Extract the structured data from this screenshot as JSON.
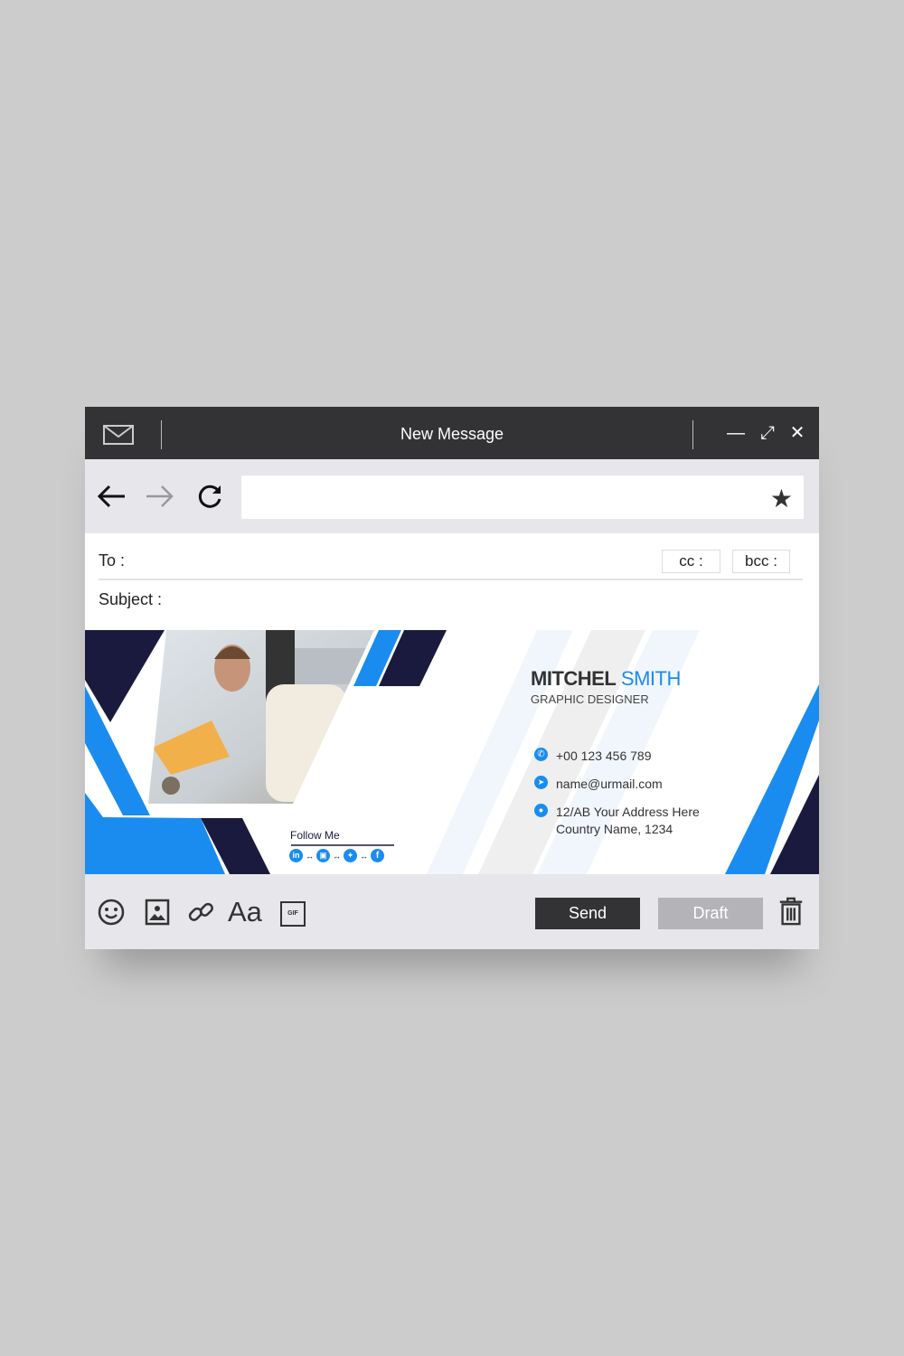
{
  "window": {
    "title": "New Message"
  },
  "compose": {
    "to_label": "To :",
    "subject_label": "Subject :",
    "cc_label": "cc :",
    "bcc_label": "bcc :",
    "url_value": ""
  },
  "signature": {
    "first_name": "MITCHEL",
    "last_name": "SMITH",
    "role": "GRAPHIC DESIGNER",
    "phone": "+00 123 456 789",
    "email": "name@urmail.com",
    "address_line1": "12/AB Your Address Here",
    "address_line2": "Country Name, 1234",
    "follow_label": "Follow Me",
    "social": [
      "linkedin-icon",
      "instagram-icon",
      "twitter-icon",
      "facebook-icon"
    ],
    "colors": {
      "blue": "#1a8cf0",
      "navy": "#1a1a3e"
    }
  },
  "footer": {
    "send_label": "Send",
    "draft_label": "Draft",
    "format_label": "Aa",
    "gif_label": "GIF"
  }
}
